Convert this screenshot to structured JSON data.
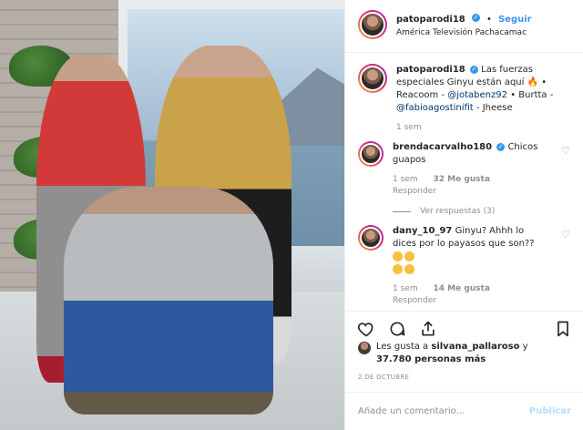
{
  "post": {
    "author": "patoparodi18",
    "follow_label": "Seguir",
    "separator": "•",
    "location": "América Televisión Pachacamac"
  },
  "caption": {
    "username": "patoparodi18",
    "text_1": "Las fuerzas especiales Ginyu están aquí",
    "emoji_1": "fire",
    "text_2": " • Reacoom -",
    "mention_1": "@jotabenz92",
    "text_3": " • Burtta -",
    "mention_2": "@fabioagostinifit",
    "text_4": " - Jheese",
    "age": "1 sem"
  },
  "comments": [
    {
      "username": "brendacarvalho180",
      "text": "Chicos guapos",
      "age": "1 sem",
      "likes": "32 Me gusta",
      "reply_label": "Responder",
      "view_replies": "Ver respuestas (3)"
    },
    {
      "username": "dany_10_97",
      "text": "Ginyu? Ahhh lo dices por lo payasos que son??",
      "emojis": [
        "thinking",
        "thinking",
        "laughing",
        "laughing"
      ],
      "age": "1 sem",
      "likes": "14 Me gusta",
      "reply_label": "Responder"
    }
  ],
  "likes_line": {
    "prefix": "Les gusta a ",
    "user": "silvana_pallaroso",
    "middle": " y",
    "count": "37.780 personas más"
  },
  "date": "2 DE OCTUBRE",
  "add_comment": {
    "placeholder": "Añade un comentario...",
    "post_label": "Publicar"
  },
  "colors": {
    "accent": "#3897f0",
    "muted": "#8e8e8e",
    "mention": "#003569"
  },
  "icons": [
    "heart-icon",
    "comment-icon",
    "share-icon",
    "bookmark-icon",
    "verified-icon"
  ]
}
